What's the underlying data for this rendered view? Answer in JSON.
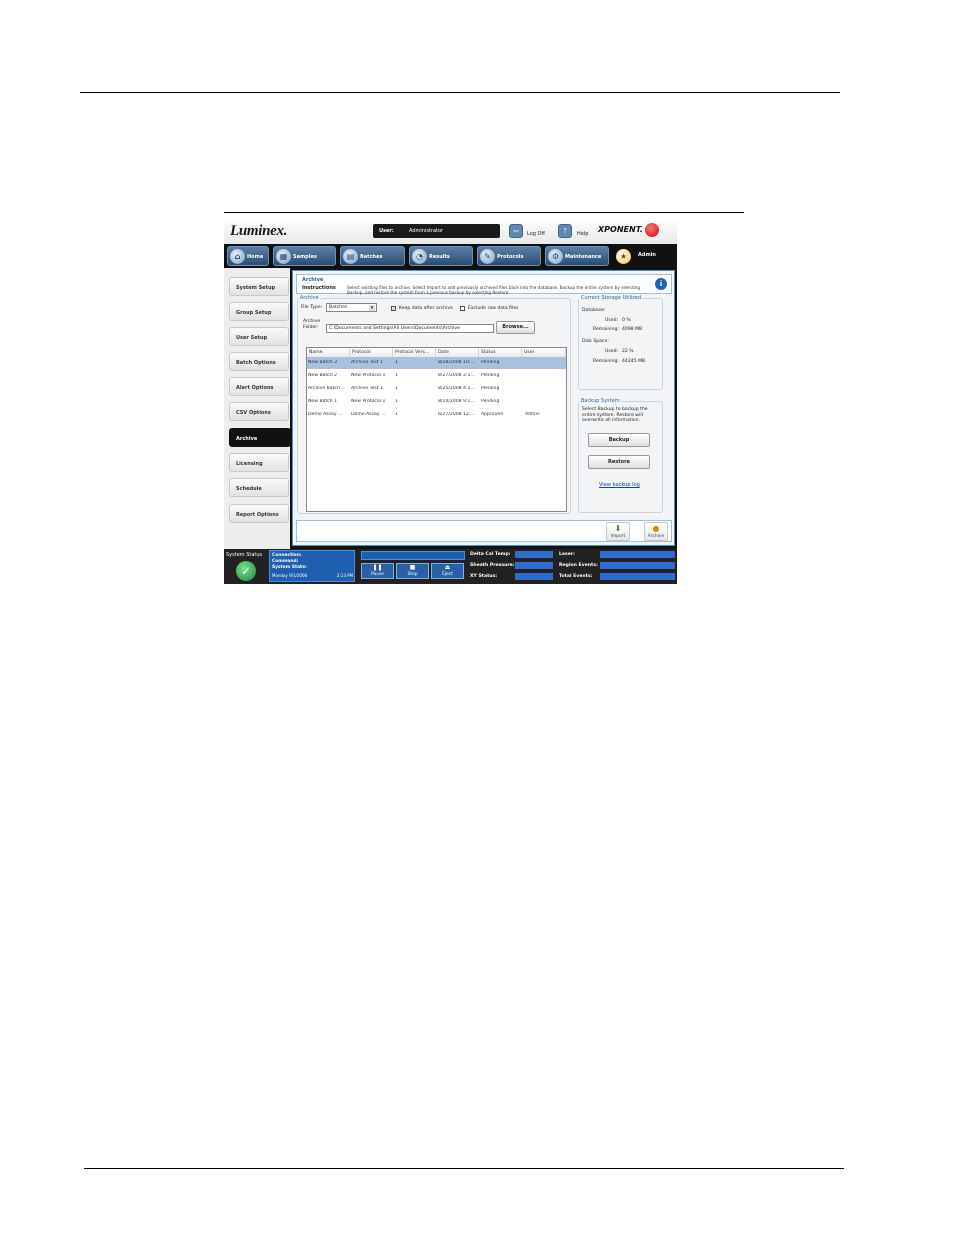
{
  "header": {
    "logo": "Luminex.",
    "user_label": "User:",
    "user_value": "Administrator",
    "logoff_label": "Log Off",
    "help_label": "Help",
    "brand": "XPONENT."
  },
  "tabs": [
    {
      "label": "Home",
      "icon": "home-icon"
    },
    {
      "label": "Samples",
      "icon": "samples-icon"
    },
    {
      "label": "Batches",
      "icon": "batches-icon"
    },
    {
      "label": "Results",
      "icon": "results-icon"
    },
    {
      "label": "Protocols",
      "icon": "protocols-icon"
    },
    {
      "label": "Maintenance",
      "icon": "maintenance-icon"
    },
    {
      "label": "Admin",
      "icon": "admin-icon"
    }
  ],
  "sidebar": {
    "items": [
      {
        "label": "System Setup"
      },
      {
        "label": "Group Setup"
      },
      {
        "label": "User Setup"
      },
      {
        "label": "Batch Options"
      },
      {
        "label": "Alert Options"
      },
      {
        "label": "CSV Options"
      },
      {
        "label": "Archive"
      },
      {
        "label": "Licensing"
      },
      {
        "label": "Schedule"
      },
      {
        "label": "Report Options"
      }
    ]
  },
  "instructions": {
    "section_title": "Archive",
    "title": "Instructions",
    "text": "Select existing files to archive. Select Import to add previously archived files back into the database. Backup the entire system by selecting Backup, and restore the system from a previous backup by selecting Restore."
  },
  "archive": {
    "group_label": "Archive",
    "file_type_label": "File Type:",
    "file_type_value": "Batches",
    "keep_data_label": "Keep data after archive",
    "keep_data_checked": true,
    "exclude_raw_label": "Exclude raw data files",
    "exclude_raw_checked": false,
    "folder_label": "Archive Folder:",
    "folder_value": "C:\\Documents and Settings\\All Users\\Documents\\Archive",
    "browse_label": "Browse...",
    "columns": [
      "Name",
      "Protocol",
      "Protocol Vers...",
      "Date",
      "Status",
      "User"
    ],
    "rows": [
      {
        "name": "New Batch 3",
        "protocol": "Archive Test 1",
        "version": "1",
        "date": "8/28/2008 10:...",
        "status": "Pending",
        "user": ""
      },
      {
        "name": "New Batch 2",
        "protocol": "New Protocol 1",
        "version": "1",
        "date": "8/27/2008 2:1...",
        "status": "Pending",
        "user": ""
      },
      {
        "name": "Archive Batch ...",
        "protocol": "Archive Test 1",
        "version": "1",
        "date": "8/25/2008 4:1...",
        "status": "Pending",
        "user": ""
      },
      {
        "name": "New Batch 1",
        "protocol": "New Protocol 1",
        "version": "1",
        "date": "8/24/2008 9:1...",
        "status": "Pending",
        "user": ""
      },
      {
        "name": "Demo Assay ...",
        "protocol": "Demo Assay ...",
        "version": "1",
        "date": "6/27/2008 12:...",
        "status": "Approved",
        "user": "Admin"
      }
    ]
  },
  "storage": {
    "group_label": "Current Storage Utilized",
    "database_label": "Database:",
    "db_used_label": "Used:",
    "db_used_value": "0 %",
    "db_remaining_label": "Remaining:",
    "db_remaining_value": "4098 MB",
    "disk_label": "Disk Space:",
    "disk_used_label": "Used:",
    "disk_used_value": "22 %",
    "disk_remaining_label": "Remaining:",
    "disk_remaining_value": "44245 MB"
  },
  "backup": {
    "group_label": "Backup System",
    "text": "Select Backup to backup the entire system. Restore will overwrite all information.",
    "backup_label": "Backup",
    "restore_label": "Restore",
    "view_log_label": "View backup log"
  },
  "actions": {
    "import_label": "Import",
    "archive_label": "Archive"
  },
  "status": {
    "system_status_label": "System Status",
    "connection_label": "Connection:",
    "command_label": "Command:",
    "system_state_label": "System State:",
    "date_text": "Monday 9/1/2008",
    "time_text": "2:13 PM",
    "pause_label": "Pause",
    "stop_label": "Stop",
    "eject_label": "Eject",
    "delta_label": "Delta Cal Temp:",
    "sheath_label": "Sheath Pressure:",
    "xy_label": "XY Status:",
    "laser_label": "Laser:",
    "region_label": "Region Events:",
    "total_label": "Total Events:"
  },
  "colors": {
    "accent_blue": "#1f5fb0",
    "selection": "#aac1dd",
    "status_ok": "#2fa84f"
  }
}
